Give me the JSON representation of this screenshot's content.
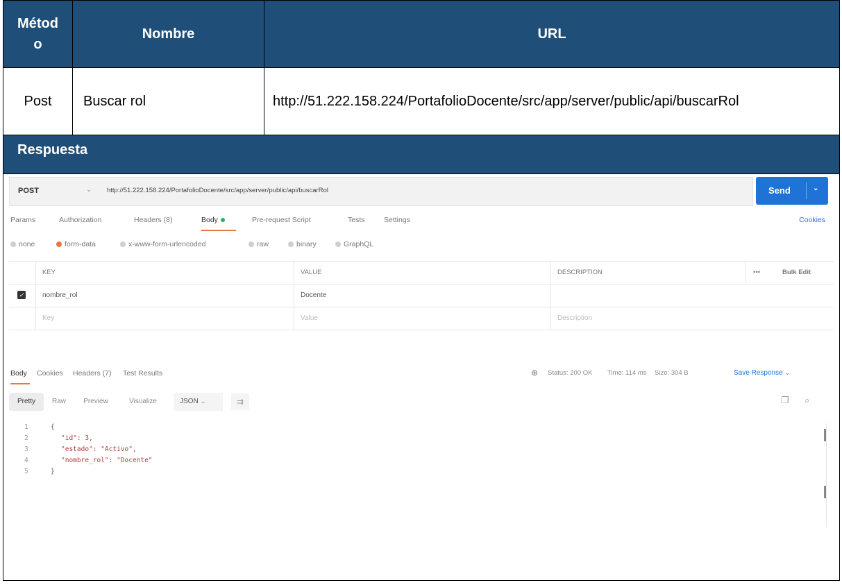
{
  "table": {
    "headers": {
      "method": "Métod o",
      "method_line1": "Métod",
      "method_line2": "o",
      "name": "Nombre",
      "url": "URL"
    },
    "row": {
      "method": "Post",
      "name": "Buscar rol",
      "url": "http://51.222.158.224/PortafolioDocente/src/app/server/public/api/buscarRol"
    },
    "response_label": "Respuesta"
  },
  "postman": {
    "method": "POST",
    "url": "http://51.222.158.224/PortafolioDocente/src/app/server/public/api/buscarRol",
    "send_label": "Send",
    "request_tabs": [
      "Params",
      "Authorization",
      "Headers (8)",
      "Body",
      "Pre-request Script",
      "Tests",
      "Settings"
    ],
    "cookies_label": "Cookies",
    "body_types": [
      "none",
      "form-data",
      "x-www-form-urlencoded",
      "raw",
      "binary",
      "GraphQL"
    ],
    "selected_body_type": "form-data",
    "params_headers": {
      "key": "KEY",
      "value": "VALUE",
      "description": "DESCRIPTION",
      "more": "•••",
      "bulk_edit": "Bulk Edit"
    },
    "params_rows": [
      {
        "key": "nombre_rol",
        "value": "Docente",
        "checked": true
      }
    ],
    "placeholders": {
      "key": "Key",
      "value": "Value",
      "description": "Description"
    },
    "response_tabs": [
      "Body",
      "Cookies",
      "Headers (7)",
      "Test Results"
    ],
    "status": "Status: 200 OK",
    "time": "Time: 114 ms",
    "size": "Size: 304 B",
    "save_response": "Save Response",
    "view_buttons": [
      "Pretty",
      "Raw",
      "Preview",
      "Visualize"
    ],
    "format": "JSON",
    "code_lines": [
      {
        "n": "1",
        "text": "{"
      },
      {
        "n": "2",
        "text": "\"id\": 3,"
      },
      {
        "n": "3",
        "text": "\"estado\": \"Activo\","
      },
      {
        "n": "4",
        "text": "\"nombre_rol\": \"Docente\""
      },
      {
        "n": "5",
        "text": "}"
      }
    ],
    "colors": {
      "accent": "#e8793c",
      "send": "#1f73d6",
      "header_bg": "#1f4e79"
    }
  }
}
